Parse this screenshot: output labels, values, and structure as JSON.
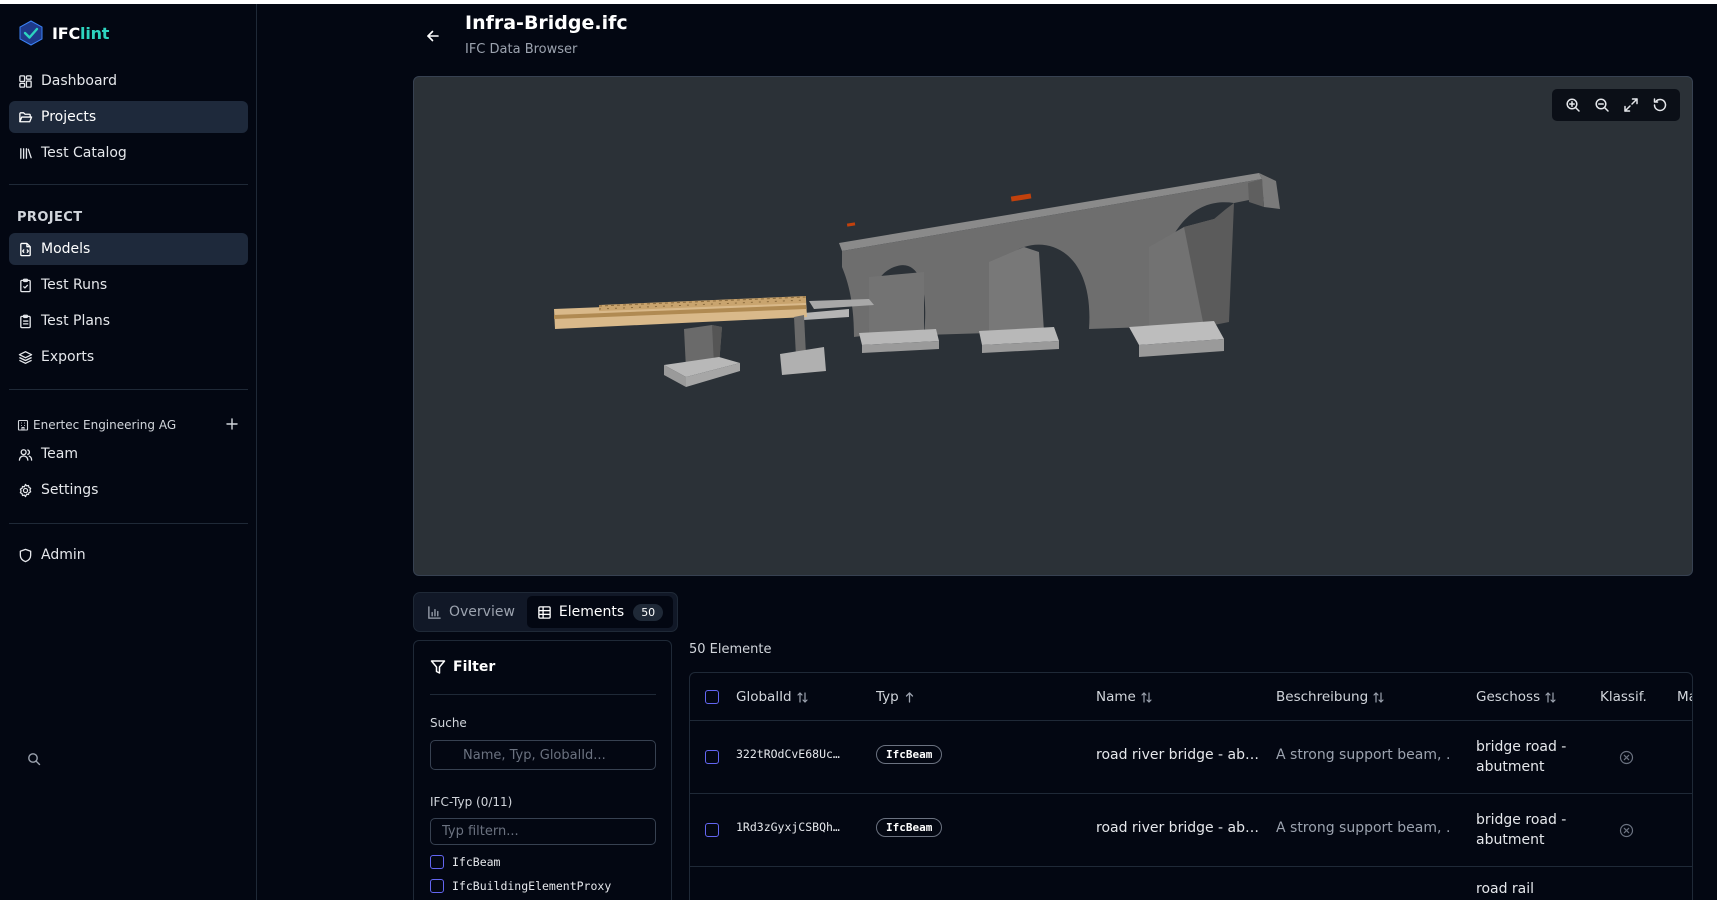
{
  "app": {
    "brand_prefix": "IFC",
    "brand_suffix": "lint",
    "accent_color": "#2dd4bf"
  },
  "sidebar": {
    "main_items": [
      {
        "label": "Dashboard",
        "icon": "dashboard-icon"
      },
      {
        "label": "Projects",
        "icon": "folder-open-icon",
        "active": true
      },
      {
        "label": "Test Catalog",
        "icon": "library-icon"
      }
    ],
    "project_section_label": "PROJECT",
    "project_items": [
      {
        "label": "Models",
        "icon": "file-code-icon",
        "active": true
      },
      {
        "label": "Test Runs",
        "icon": "clipboard-check-icon"
      },
      {
        "label": "Test Plans",
        "icon": "clipboard-list-icon"
      },
      {
        "label": "Exports",
        "icon": "layers-icon"
      }
    ],
    "organization": "Enertec Engineering AG",
    "org_items": [
      {
        "label": "Team",
        "icon": "users-icon"
      },
      {
        "label": "Settings",
        "icon": "gear-icon"
      }
    ],
    "admin_label": "Admin"
  },
  "header": {
    "title": "Infra-Bridge.ifc",
    "subtitle": "IFC Data Browser"
  },
  "viewer": {
    "tools": [
      "zoom-in-icon",
      "zoom-out-icon",
      "fullscreen-icon",
      "reset-view-icon"
    ]
  },
  "tabs": [
    {
      "label": "Overview",
      "icon": "bar-chart-icon",
      "active": false
    },
    {
      "label": "Elements",
      "icon": "table-icon",
      "active": true,
      "badge": "50"
    }
  ],
  "filter": {
    "title": "Filter",
    "search_label": "Suche",
    "search_placeholder": "Name, Typ, GlobalId...",
    "type_label": "IFC-Typ (0/11)",
    "type_placeholder": "Typ filtern...",
    "type_options": [
      "IfcBeam",
      "IfcBuildingElementProxy"
    ]
  },
  "table": {
    "count_label": "50 Elemente",
    "columns": [
      "GlobalId",
      "Typ",
      "Name",
      "Beschreibung",
      "Geschoss",
      "Klassif.",
      "Ma"
    ],
    "rows": [
      {
        "global_id": "322tROdCvE68Uc…",
        "type": "IfcBeam",
        "name": "road river bridge - ab…",
        "description": "A strong support beam, …",
        "storey": "bridge road - abutment"
      },
      {
        "global_id": "1Rd3zGyxjCSBQh…",
        "type": "IfcBeam",
        "name": "road river bridge - ab…",
        "description": "A strong support beam, …",
        "storey": "bridge road - abutment"
      },
      {
        "global_id": "",
        "type": "",
        "name": "",
        "description": "",
        "storey": "road rail"
      }
    ]
  }
}
